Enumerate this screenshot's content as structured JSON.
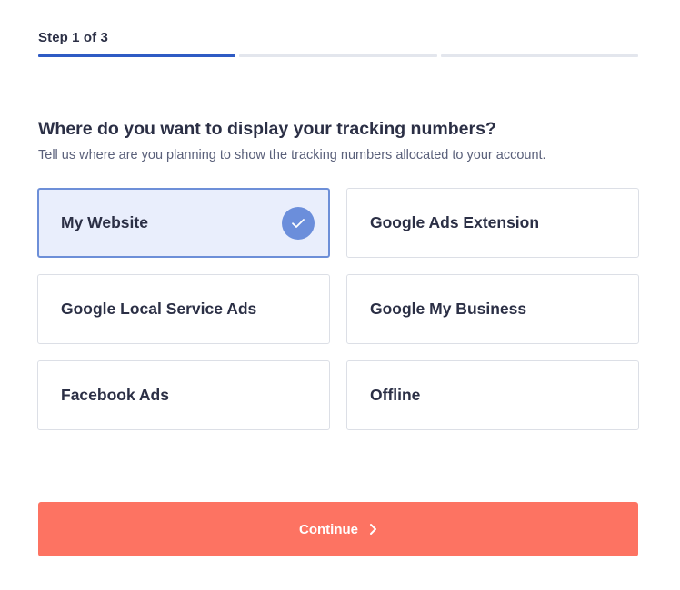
{
  "stepper": {
    "label": "Step 1 of 3",
    "current_step": 1,
    "total_steps": 3,
    "active_color": "#2f5bc4",
    "inactive_color": "#e3e6ed"
  },
  "question": {
    "title": "Where do you want to display your tracking numbers?",
    "subtitle": "Tell us where are you planning to show the tracking numbers allocated to your account."
  },
  "options": [
    {
      "label": "My Website",
      "selected": true
    },
    {
      "label": "Google Ads Extension",
      "selected": false
    },
    {
      "label": "Google Local Service Ads",
      "selected": false
    },
    {
      "label": "Google My Business",
      "selected": false
    },
    {
      "label": "Facebook Ads",
      "selected": false
    },
    {
      "label": "Offline",
      "selected": false
    }
  ],
  "selected_color": "#6b8edb",
  "continue_button": {
    "label": "Continue",
    "icon": "chevron-right-icon",
    "color": "#fd7362"
  }
}
